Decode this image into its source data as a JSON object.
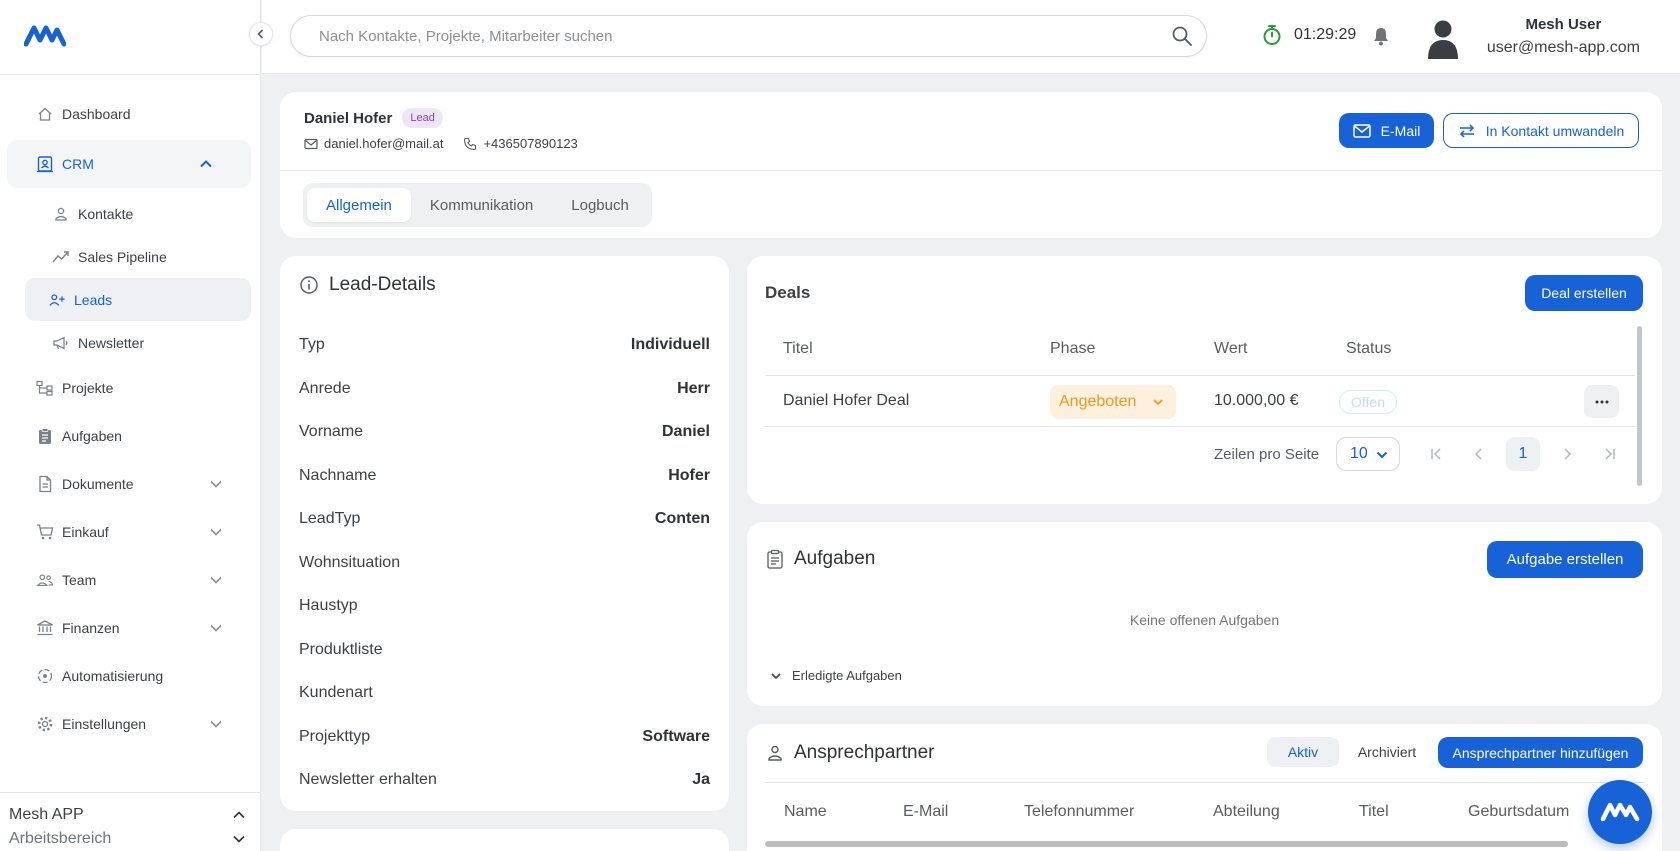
{
  "brand": {
    "accent": "#1662d6"
  },
  "sidebar": {
    "items": [
      {
        "label": "Dashboard",
        "icon": "home-icon"
      },
      {
        "label": "CRM",
        "icon": "crm-icon",
        "expanded": true
      },
      {
        "label": "Projekte",
        "icon": "projects-icon"
      },
      {
        "label": "Aufgaben",
        "icon": "tasks-icon"
      },
      {
        "label": "Dokumente",
        "icon": "document-icon"
      },
      {
        "label": "Einkauf",
        "icon": "cart-icon"
      },
      {
        "label": "Team",
        "icon": "team-icon"
      },
      {
        "label": "Finanzen",
        "icon": "bank-icon"
      },
      {
        "label": "Automatisierung",
        "icon": "automation-icon"
      },
      {
        "label": "Einstellungen",
        "icon": "gear-icon"
      }
    ],
    "crm_sub": [
      {
        "label": "Kontakte",
        "icon": "person-icon"
      },
      {
        "label": "Sales Pipeline",
        "icon": "trend-icon"
      },
      {
        "label": "Leads",
        "icon": "add-person-icon",
        "active": true
      },
      {
        "label": "Newsletter",
        "icon": "megaphone-icon"
      }
    ],
    "workspace": {
      "app": "Mesh APP",
      "area": "Arbeitsbereich"
    }
  },
  "topbar": {
    "search_placeholder": "Nach Kontakte, Projekte, Mitarbeiter suchen",
    "timer": "01:29:29",
    "user_name": "Mesh User",
    "user_email": "user@mesh-app.com"
  },
  "lead": {
    "name": "Daniel Hofer",
    "badge": "Lead",
    "email": "daniel.hofer@mail.at",
    "phone": "+436507890123",
    "email_button": "E-Mail",
    "convert_button": "In Kontakt umwandeln",
    "tabs": [
      "Allgemein",
      "Kommunikation",
      "Logbuch"
    ],
    "active_tab": "Allgemein"
  },
  "details": {
    "title": "Lead-Details",
    "rows": [
      {
        "label": "Typ",
        "value": "Individuell"
      },
      {
        "label": "Anrede",
        "value": "Herr"
      },
      {
        "label": "Vorname",
        "value": "Daniel"
      },
      {
        "label": "Nachname",
        "value": "Hofer"
      },
      {
        "label": "LeadTyp",
        "value": "Conten"
      },
      {
        "label": "Wohnsituation",
        "value": ""
      },
      {
        "label": "Haustyp",
        "value": ""
      },
      {
        "label": "Produktliste",
        "value": ""
      },
      {
        "label": "Kundenart",
        "value": ""
      },
      {
        "label": "Projekttyp",
        "value": "Software"
      },
      {
        "label": "Newsletter erhalten",
        "value": "Ja"
      }
    ]
  },
  "deals": {
    "title": "Deals",
    "create_button": "Deal erstellen",
    "columns": [
      "Titel",
      "Phase",
      "Wert",
      "Status"
    ],
    "rows": [
      {
        "title": "Daniel Hofer Deal",
        "phase": "Angeboten",
        "value": "10.000,00 €",
        "status": "Offen"
      }
    ],
    "rows_per_page_label": "Zeilen pro Seite",
    "rows_per_page": "10",
    "page": "1"
  },
  "tasks": {
    "title": "Aufgaben",
    "create_button": "Aufgabe erstellen",
    "empty": "Keine offenen Aufgaben",
    "done_toggle": "Erledigte Aufgaben"
  },
  "contacts": {
    "title": "Ansprechpartner",
    "seg_active": "Aktiv",
    "seg_archived": "Archiviert",
    "add_button": "Ansprechpartner hinzufügen",
    "columns": [
      "Name",
      "E-Mail",
      "Telefonnummer",
      "Abteilung",
      "Titel",
      "Geburtsdatum"
    ]
  }
}
